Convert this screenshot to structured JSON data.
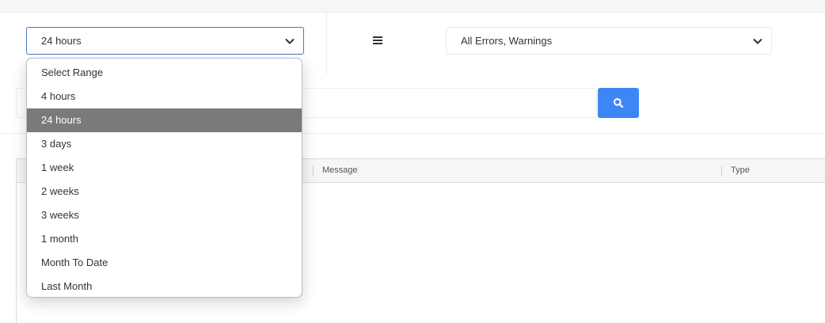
{
  "filters": {
    "range_selected": "24 hours",
    "level_selected": "All Errors, Warnings"
  },
  "range_options": [
    "Select Range",
    "4 hours",
    "24 hours",
    "3 days",
    "1 week",
    "2 weeks",
    "3 weeks",
    "1 month",
    "Month To Date",
    "Last Month"
  ],
  "grid": {
    "columns": [
      "Message",
      "Type"
    ]
  },
  "icons": {
    "menu": "hamburger-icon",
    "search": "search-icon",
    "chevron": "chevron-down-icon"
  },
  "colors": {
    "accent": "#3d86f5",
    "selected_option_bg": "#7a7a7a",
    "focus_border": "#4a76c4"
  }
}
